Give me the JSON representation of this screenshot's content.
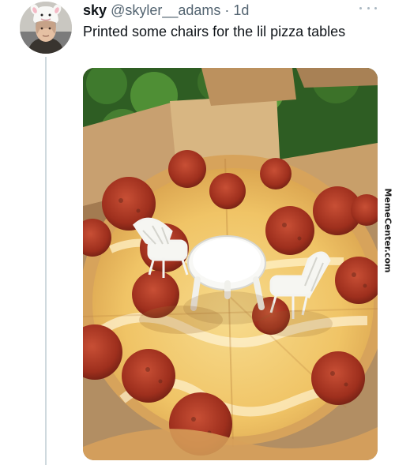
{
  "tweet": {
    "display_name": "sky",
    "handle": "@skyler__adams",
    "separator": "·",
    "time": "1d",
    "text": "Printed some chairs for the lil pizza tables",
    "avatar_icon": "user-avatar-photo",
    "more_icon": "more-options-icon",
    "media_description_icon": "pizza-photo"
  },
  "watermark": {
    "text": "MemeCenter.com"
  },
  "colors": {
    "text_primary": "#0f1419",
    "text_secondary": "#536471",
    "thread_line": "#cfd9de",
    "pizza_cheese": "#f2c76a",
    "pepperoni": "#a63622",
    "box_cardboard": "#b28e63",
    "plastic_white": "#f4f4f1"
  }
}
